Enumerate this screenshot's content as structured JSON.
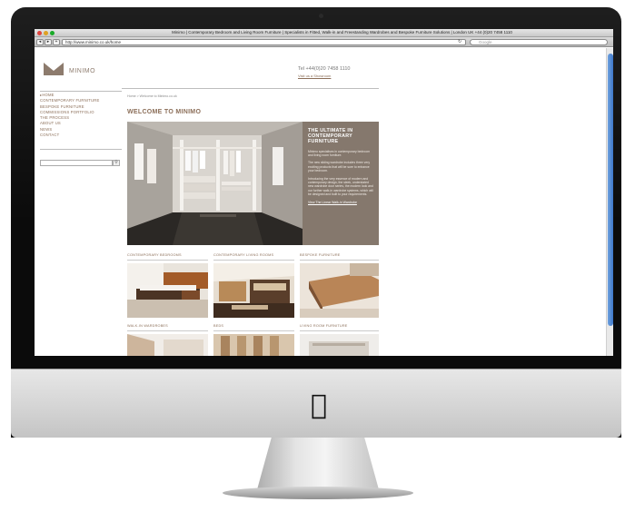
{
  "browser": {
    "window_title": "Minimo | Contemporary Bedroom and Living Room Furniture | Specialists in Fitted, Walk-in and Freestanding Wardrobes and Bespoke Furniture Solutions | London UK +44 (0)20 7458 1110",
    "url": "http://www.minimo.co.uk/home",
    "search_placeholder": "Google",
    "back_label": "◂",
    "forward_label": "▸",
    "add_label": "+",
    "refresh_icon": "refresh-icon"
  },
  "site": {
    "logo_text": "MINIMO",
    "phone": "Tel +44(0)20 7458 1110",
    "visit_link": "Visit us a Showroom",
    "breadcrumb": "Home > Welcome to Minimo.co.uk",
    "welcome_heading": "WELCOME TO MINIMO",
    "nav": [
      {
        "label": "HOME"
      },
      {
        "label": "CONTEMPORARY FURNITURE"
      },
      {
        "label": "BESPOKE FURNITURE"
      },
      {
        "label": "COMMISSIONS PORTFOLIO"
      },
      {
        "label": "THE PROCESS"
      },
      {
        "label": "ABOUT US"
      },
      {
        "label": "NEWS"
      },
      {
        "label": "CONTACT"
      }
    ],
    "side_search_button": "🔍",
    "hero": {
      "heading": "THE ULTIMATE IN CONTEMPORARY FURNITURE",
      "paragraphs": [
        "Minimo specialises in contemporary bedroom and living room furniture.",
        "The new sliding wardrobe includes three very exciting products that will be sure to enhance your bedroom.",
        "Introducing the very essence of modern and contemporary design, the sleek, understated new wardrobe door series, the modern look and our further walk-in wardrobe systems, which will be designed and built to your requirements."
      ],
      "link": "View The Linear Walk-in Wardrobe"
    },
    "categories": [
      {
        "label": "CONTEMPORARY BEDROOMS"
      },
      {
        "label": "CONTEMPORARY LIVING ROOMS"
      },
      {
        "label": "BESPOKE FURNITURE"
      },
      {
        "label": "WALK-IN WARDROBES"
      },
      {
        "label": "BEDS"
      },
      {
        "label": "LIVING ROOM FURNITURE"
      }
    ]
  },
  "colors": {
    "brand_brown": "#8b6e58",
    "hero_panel": "#85786d",
    "scroll_thumb": "#3d77c9"
  }
}
